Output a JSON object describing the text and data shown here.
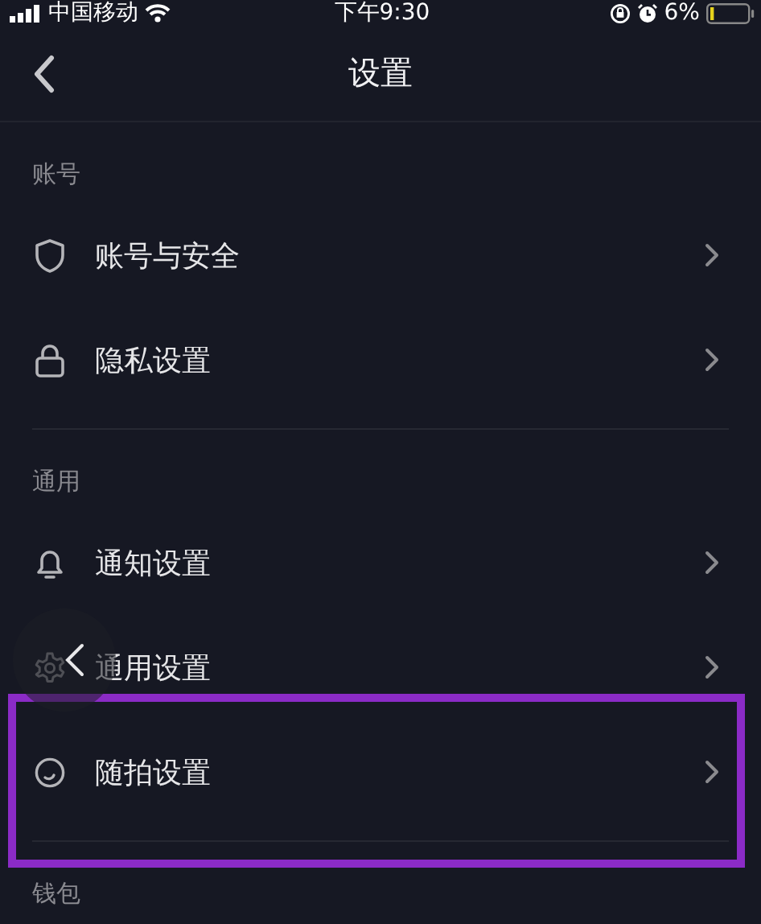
{
  "status_bar": {
    "carrier": "中国移动",
    "time": "下午9:30",
    "battery": "6%"
  },
  "nav": {
    "title": "设置"
  },
  "sections": [
    {
      "title": "账号",
      "items": [
        {
          "label": "账号与安全",
          "highlighted": false
        },
        {
          "label": "隐私设置",
          "highlighted": false
        }
      ]
    },
    {
      "title": "通用",
      "items": [
        {
          "label": "通知设置",
          "highlighted": false
        },
        {
          "label": "通用设置",
          "highlighted": false
        },
        {
          "label": "随拍设置",
          "highlighted": true
        }
      ]
    },
    {
      "title": "钱包"
    }
  ]
}
